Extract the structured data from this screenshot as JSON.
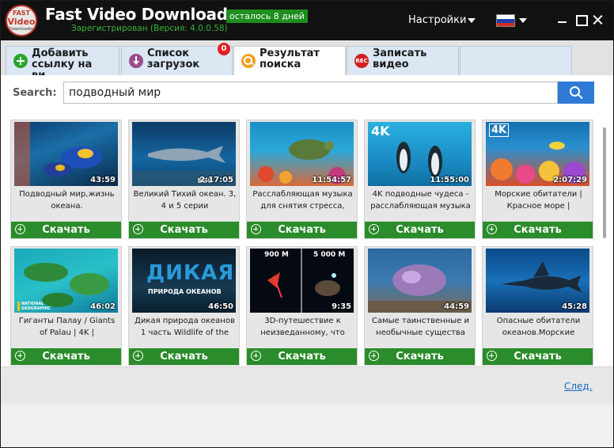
{
  "app": {
    "logo_line1": "FAST",
    "logo_line2": "Video",
    "logo_line3": "Downloader",
    "title": "Fast Video Downloader",
    "days_badge": "осталось 8 дней",
    "registration": "Зарегистрирован (Версия: 4.0.0.58)",
    "settings_label": "Настройки",
    "language_flag": "russia-flag-icon"
  },
  "tabs": [
    {
      "label_line1": "Добавить",
      "label_line2": "ссылку на ви...",
      "icon": "add-icon",
      "active": false
    },
    {
      "label_line1": "Список",
      "label_line2": "загрузок",
      "icon": "download-icon",
      "active": false,
      "badge": "0"
    },
    {
      "label_line1": "Результат",
      "label_line2": "поиска",
      "icon": "search-icon",
      "active": true
    },
    {
      "label_line1": "Записать",
      "label_line2": "видео",
      "icon": "rec-icon",
      "icon_text": "REC",
      "active": false
    },
    {
      "label_line1": "",
      "label_line2": "",
      "active": false
    }
  ],
  "search": {
    "label": "Search:",
    "value": "подводный мир"
  },
  "download_label": "Скачать",
  "videos": [
    {
      "title": "Подводный мир,жизнь океана.",
      "duration": "43:59"
    },
    {
      "title": "Великий Тихий океан. 3, 4 и 5 серии",
      "duration": "2:17:05",
      "overlay": "BBC"
    },
    {
      "title": "Расслабляющая музыка для снятия стресса,",
      "duration": "11:54:57"
    },
    {
      "title": "4K подводные чудеса - расслабляющая музыка",
      "duration": "11:55:00",
      "overlay": "4K"
    },
    {
      "title": "Морские обитатели | Красное море |",
      "duration": "2:07:29",
      "overlay": "4K"
    },
    {
      "title": "Гиганты Палау / Giants of Palau | 4K |",
      "duration": "46:02",
      "overlay": "NATIONAL GEOGRAPHIC"
    },
    {
      "title": "Дикая природа океанов 1 часть  Wildlife of the",
      "duration": "46:50",
      "overlay": "ДИКАЯ",
      "overlay2": "ПРИРОДА ОКЕАНОВ"
    },
    {
      "title": "3D-путешествие к неизведанному, что",
      "duration": "9:35",
      "overlay": "900 M",
      "overlay2": "5 000 M"
    },
    {
      "title": "Самые таинственные и необычные существа",
      "duration": "44:59"
    },
    {
      "title": "Опасные обитатели океанов.Морские",
      "duration": "45:28"
    }
  ],
  "footer": {
    "next_link": "След."
  }
}
